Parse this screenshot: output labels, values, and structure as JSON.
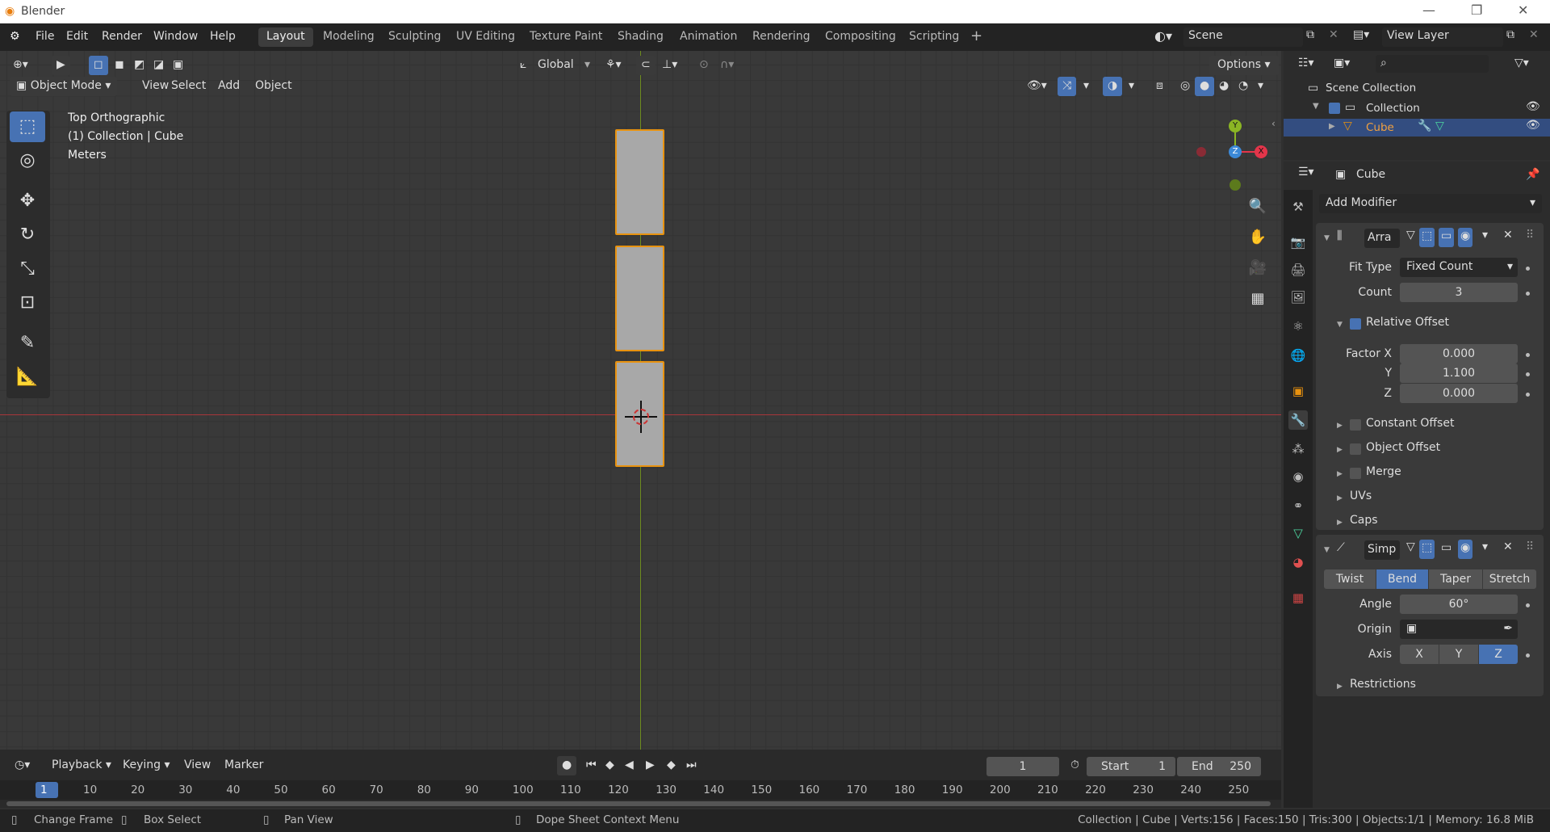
{
  "window": {
    "title": "Blender"
  },
  "menus": [
    "File",
    "Edit",
    "Render",
    "Window",
    "Help"
  ],
  "workspaces": [
    "Layout",
    "Modeling",
    "Sculpting",
    "UV Editing",
    "Texture Paint",
    "Shading",
    "Animation",
    "Rendering",
    "Compositing",
    "Scripting"
  ],
  "active_workspace": "Layout",
  "scene": "Scene",
  "view_layer": "View Layer",
  "viewport": {
    "mode": "Object Mode",
    "menu": [
      "View",
      "Select",
      "Add",
      "Object"
    ],
    "orientation": "Global",
    "options_label": "Options",
    "overlay_lines": [
      "Top Orthographic",
      "(1) Collection | Cube",
      "Meters"
    ],
    "gizmo": {
      "y": "Y",
      "z": "Z",
      "x": "X"
    }
  },
  "outliner": {
    "scene_collection": "Scene Collection",
    "collection": "Collection",
    "object": "Cube"
  },
  "properties": {
    "object_name": "Cube",
    "add_modifier": "Add Modifier",
    "array": {
      "name": "Arra",
      "fit_type_label": "Fit Type",
      "fit_type": "Fixed Count",
      "count_label": "Count",
      "count": "3",
      "relative_offset": "Relative Offset",
      "factor_x_label": "Factor X",
      "factor_x": "0.000",
      "y_label": "Y",
      "y": "1.100",
      "z_label": "Z",
      "z": "0.000",
      "constant_offset": "Constant Offset",
      "object_offset": "Object Offset",
      "merge": "Merge",
      "uvs": "UVs",
      "caps": "Caps"
    },
    "simple_deform": {
      "name": "Simp",
      "modes": [
        "Twist",
        "Bend",
        "Taper",
        "Stretch"
      ],
      "active_mode": "Bend",
      "angle_label": "Angle",
      "angle": "60°",
      "origin_label": "Origin",
      "axis_label": "Axis",
      "axes": [
        "X",
        "Y",
        "Z"
      ],
      "active_axis": "Z",
      "restrictions": "Restrictions"
    }
  },
  "timeline": {
    "menus": [
      "Playback",
      "Keying",
      "View",
      "Marker"
    ],
    "current_frame": "1",
    "start_label": "Start",
    "start": "1",
    "end_label": "End",
    "end": "250",
    "ruler": [
      "1",
      "10",
      "20",
      "30",
      "40",
      "50",
      "60",
      "70",
      "80",
      "90",
      "100",
      "110",
      "120",
      "130",
      "140",
      "150",
      "160",
      "170",
      "180",
      "190",
      "200",
      "210",
      "220",
      "230",
      "240",
      "250"
    ]
  },
  "statusbar": {
    "change_frame": "Change Frame",
    "box_select": "Box Select",
    "pan_view": "Pan View",
    "context_menu": "Dope Sheet Context Menu",
    "stats": "Collection | Cube | Verts:156 | Faces:150 | Tris:300 | Objects:1/1 | Memory: 16.8 MiB"
  },
  "colors": {
    "accent": "#4772b3",
    "selection": "#e8920f",
    "x_axis": "#c8353d",
    "y_axis": "#7ca420"
  }
}
